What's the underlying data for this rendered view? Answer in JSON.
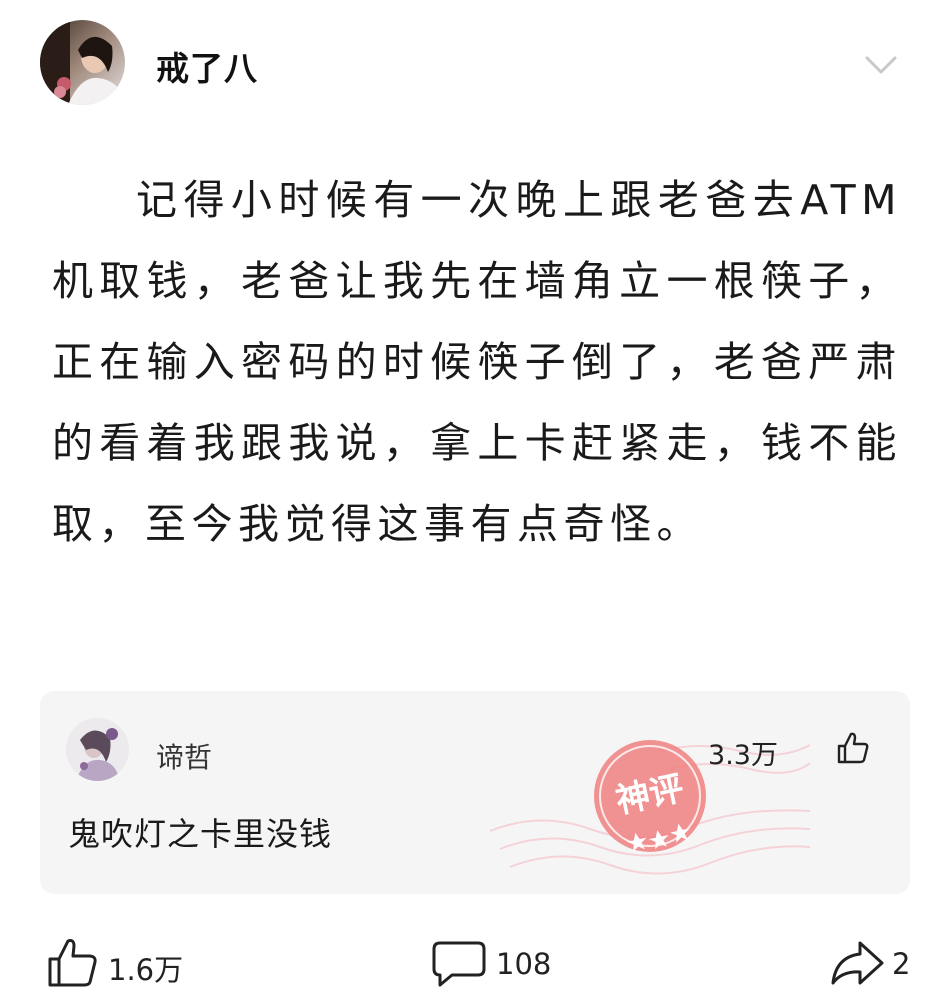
{
  "post": {
    "author": "戒了八",
    "avatar_icon": "user-avatar-photo",
    "menu_icon": "chevron-down-icon",
    "text": "记得小时候有一次晚上跟老爸去ATM机取钱，老爸让我先在墙角立一根筷子，正在输入密码的时候筷子倒了，老爸严肃的看着我跟我说，拿上卡赶紧走，钱不能取，至今我觉得这事有点奇怪。"
  },
  "top_comment": {
    "author": "谛哲",
    "likes": "3.3万",
    "text": "鬼吹灯之卡里没钱",
    "stamp_label": "神评",
    "stamp_color": "#f08080"
  },
  "actions": {
    "like_count": "1.6万",
    "comment_count": "108",
    "share_count": "2"
  },
  "colors": {
    "background": "#ffffff",
    "card_background": "#f5f5f5",
    "text": "#1a1a1a"
  }
}
